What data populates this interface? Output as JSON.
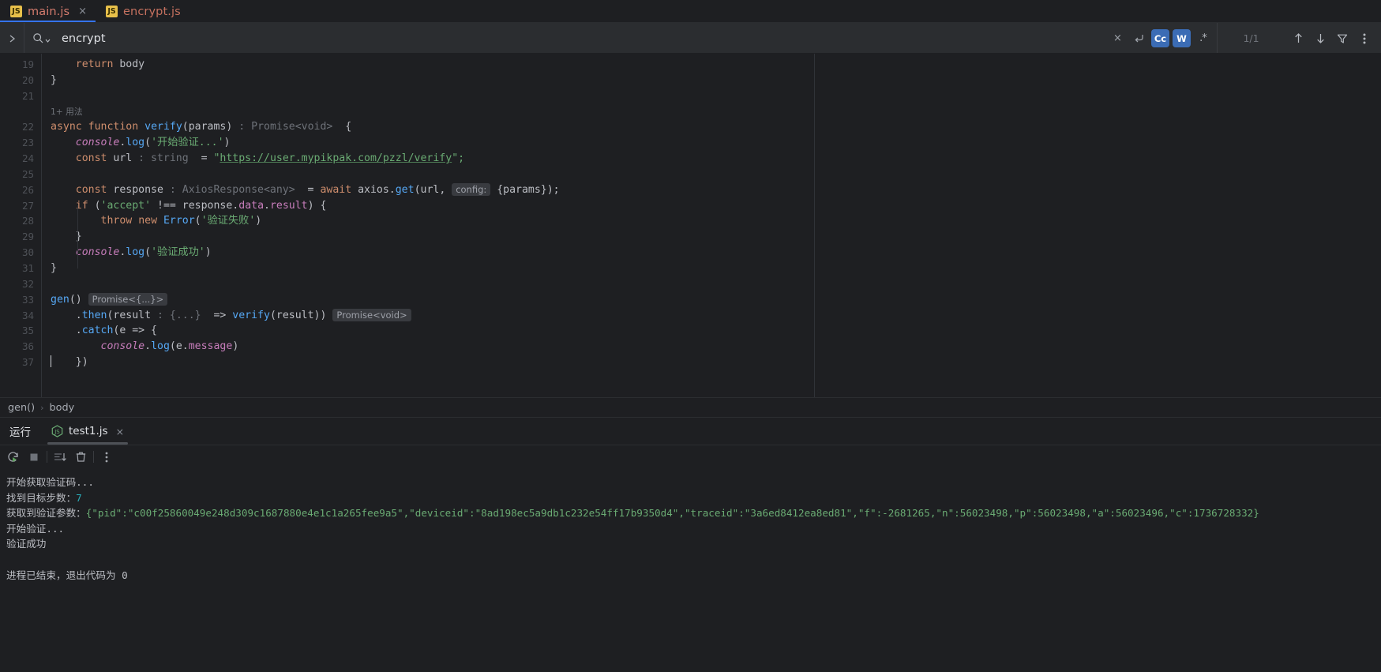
{
  "colors": {
    "bg": "#1e1f22",
    "toolbar_bg": "#2b2d30",
    "accent_blue": "#3574f0",
    "toggle_active": "#3b6cb5",
    "keyword": "#cf8e6d",
    "function": "#56a8f5",
    "string": "#6aab73",
    "number": "#2aacb8",
    "hint": "#6e7279",
    "js_tab": "#d47b6d"
  },
  "tabs": [
    {
      "label": "main.js",
      "icon": "js-file-icon",
      "badge": "JS",
      "active": true,
      "closable": true
    },
    {
      "label": "encrypt.js",
      "icon": "js-file-icon",
      "badge": "JS",
      "active": false,
      "closable": false
    }
  ],
  "search": {
    "expand_icon": "chevron-right-icon",
    "magnifier_icon": "search-dropdown-icon",
    "value": "encrypt",
    "placeholder": "",
    "clear_label": "×",
    "newline_label": "↩",
    "match_case_label": "Cc",
    "words_label": "W",
    "regex_label": ".*",
    "match_case_on": true,
    "words_on": true,
    "regex_on": false,
    "count": "1/1",
    "prev_icon": "arrow-up-icon",
    "next_icon": "arrow-down-icon",
    "filter_icon": "filter-icon",
    "more_icon": "more-vertical-icon"
  },
  "editor": {
    "first_line": 19,
    "usage_hint": "1+ 用法",
    "lines": [
      {
        "num": "19",
        "segments": [
          {
            "t": "    ",
            "c": "ident"
          },
          {
            "t": "return",
            "c": "kw"
          },
          {
            "t": " body",
            "c": "ident"
          }
        ]
      },
      {
        "num": "20",
        "segments": [
          {
            "t": "}",
            "c": "ident"
          }
        ]
      },
      {
        "num": "21",
        "segments": []
      },
      {
        "num": "",
        "segments": [
          {
            "t": "1+ 用法",
            "c": "usage"
          }
        ]
      },
      {
        "num": "22",
        "segments": [
          {
            "t": "async",
            "c": "kw"
          },
          {
            "t": " ",
            "c": "ident"
          },
          {
            "t": "function",
            "c": "kw"
          },
          {
            "t": " ",
            "c": "ident"
          },
          {
            "t": "verify",
            "c": "fn"
          },
          {
            "t": "(params)",
            "c": "ident"
          },
          {
            "t": " : Promise<void>",
            "c": "hint"
          },
          {
            "t": "  {",
            "c": "ident"
          }
        ]
      },
      {
        "num": "23",
        "segments": [
          {
            "t": "    ",
            "c": "ident"
          },
          {
            "t": "console",
            "c": "consolei"
          },
          {
            "t": ".",
            "c": "ident"
          },
          {
            "t": "log",
            "c": "fn"
          },
          {
            "t": "(",
            "c": "ident"
          },
          {
            "t": "'开始验证...'",
            "c": "str"
          },
          {
            "t": ")",
            "c": "ident"
          }
        ]
      },
      {
        "num": "24",
        "segments": [
          {
            "t": "    ",
            "c": "ident"
          },
          {
            "t": "const",
            "c": "kw"
          },
          {
            "t": " url",
            "c": "ident"
          },
          {
            "t": " : string",
            "c": "hint"
          },
          {
            "t": "  = ",
            "c": "ident"
          },
          {
            "t": "\"",
            "c": "str"
          },
          {
            "t": "https://user.mypikpak.com/pzzl/verify",
            "c": "link"
          },
          {
            "t": "\";",
            "c": "str"
          }
        ]
      },
      {
        "num": "25",
        "segments": []
      },
      {
        "num": "26",
        "segments": [
          {
            "t": "    ",
            "c": "ident"
          },
          {
            "t": "const",
            "c": "kw"
          },
          {
            "t": " response",
            "c": "ident"
          },
          {
            "t": " : AxiosResponse<any>",
            "c": "hint"
          },
          {
            "t": "  = ",
            "c": "ident"
          },
          {
            "t": "await",
            "c": "kw"
          },
          {
            "t": " axios",
            "c": "ident"
          },
          {
            "t": ".",
            "c": "ident"
          },
          {
            "t": "get",
            "c": "fn"
          },
          {
            "t": "(url, ",
            "c": "ident"
          },
          {
            "t": "config:",
            "c": "chip"
          },
          {
            "t": " {params});",
            "c": "ident"
          }
        ]
      },
      {
        "num": "27",
        "segments": [
          {
            "t": "    ",
            "c": "ident"
          },
          {
            "t": "if",
            "c": "kw"
          },
          {
            "t": " (",
            "c": "ident"
          },
          {
            "t": "'accept'",
            "c": "str"
          },
          {
            "t": " !== response",
            "c": "ident"
          },
          {
            "t": ".",
            "c": "ident"
          },
          {
            "t": "data",
            "c": "field"
          },
          {
            "t": ".",
            "c": "ident"
          },
          {
            "t": "result",
            "c": "field"
          },
          {
            "t": ") {",
            "c": "ident"
          }
        ]
      },
      {
        "num": "28",
        "segments": [
          {
            "t": "        ",
            "c": "ident"
          },
          {
            "t": "throw",
            "c": "kw"
          },
          {
            "t": " ",
            "c": "ident"
          },
          {
            "t": "new",
            "c": "kw"
          },
          {
            "t": " ",
            "c": "ident"
          },
          {
            "t": "Error",
            "c": "cls"
          },
          {
            "t": "(",
            "c": "ident"
          },
          {
            "t": "'验证失败'",
            "c": "str"
          },
          {
            "t": ")",
            "c": "ident"
          }
        ]
      },
      {
        "num": "29",
        "segments": [
          {
            "t": "    }",
            "c": "ident"
          }
        ]
      },
      {
        "num": "30",
        "segments": [
          {
            "t": "    ",
            "c": "ident"
          },
          {
            "t": "console",
            "c": "consolei"
          },
          {
            "t": ".",
            "c": "ident"
          },
          {
            "t": "log",
            "c": "fn"
          },
          {
            "t": "(",
            "c": "ident"
          },
          {
            "t": "'验证成功'",
            "c": "str"
          },
          {
            "t": ")",
            "c": "ident"
          }
        ]
      },
      {
        "num": "31",
        "segments": [
          {
            "t": "}",
            "c": "ident"
          }
        ]
      },
      {
        "num": "32",
        "segments": []
      },
      {
        "num": "33",
        "segments": [
          {
            "t": "gen",
            "c": "fn"
          },
          {
            "t": "()",
            "c": "ident"
          },
          {
            "t": " ",
            "c": "ident"
          },
          {
            "t": "Promise<{...}>",
            "c": "chip"
          }
        ]
      },
      {
        "num": "34",
        "segments": [
          {
            "t": "    ",
            "c": "ident"
          },
          {
            "t": ".",
            "c": "ident"
          },
          {
            "t": "then",
            "c": "fn"
          },
          {
            "t": "(result",
            "c": "ident"
          },
          {
            "t": " : {...}",
            "c": "hint"
          },
          {
            "t": "  => ",
            "c": "ident"
          },
          {
            "t": "verify",
            "c": "fn"
          },
          {
            "t": "(result))",
            "c": "ident"
          },
          {
            "t": " ",
            "c": "ident"
          },
          {
            "t": "Promise<void>",
            "c": "chip"
          }
        ]
      },
      {
        "num": "35",
        "segments": [
          {
            "t": "    ",
            "c": "ident"
          },
          {
            "t": ".",
            "c": "ident"
          },
          {
            "t": "catch",
            "c": "fn"
          },
          {
            "t": "(e => {",
            "c": "ident"
          }
        ]
      },
      {
        "num": "36",
        "segments": [
          {
            "t": "        ",
            "c": "ident"
          },
          {
            "t": "console",
            "c": "consolei"
          },
          {
            "t": ".",
            "c": "ident"
          },
          {
            "t": "log",
            "c": "fn"
          },
          {
            "t": "(e",
            "c": "ident"
          },
          {
            "t": ".",
            "c": "ident"
          },
          {
            "t": "message",
            "c": "field"
          },
          {
            "t": ")",
            "c": "ident"
          }
        ]
      },
      {
        "num": "37",
        "segments": [
          {
            "t": "    })",
            "c": "ident"
          }
        ]
      }
    ]
  },
  "breadcrumb": {
    "items": [
      "gen()",
      "body"
    ],
    "separator": "›"
  },
  "run": {
    "title": "运行",
    "tab_label": "test1.js",
    "tab_icon": "nodejs-icon",
    "tab_close": "×",
    "toolbar": {
      "rerun": "rerun-icon",
      "stop": "stop-icon",
      "scroll_end": "scroll-to-end-icon",
      "trash": "trash-icon",
      "more": "more-vertical-icon"
    },
    "console_lines": [
      {
        "text": "开始获取验证码...",
        "kind": "plain"
      },
      {
        "text": "找到目标步数：7",
        "kind": "with-number",
        "prefix": "找到目标步数：",
        "number": "7"
      },
      {
        "text": "获取到验证参数：{\"pid\":\"c00f25860049e248d309c1687880e4e1c1a265fee9a5\",\"deviceid\":\"8ad198ec5a9db1c232e54ff17b9350d4\",\"traceid\":\"3a6ed8412ea8ed81\",\"f\":-2681265,\"n\":56023498,\"p\":56023498,\"a\":56023496,\"c\":1736728332}",
        "kind": "json",
        "prefix": "获取到验证参数：",
        "json": "{\"pid\":\"c00f25860049e248d309c1687880e4e1c1a265fee9a5\",\"deviceid\":\"8ad198ec5a9db1c232e54ff17b9350d4\",\"traceid\":\"3a6ed8412ea8ed81\",\"f\":-2681265,\"n\":56023498,\"p\":56023498,\"a\":56023496,\"c\":1736728332}"
      },
      {
        "text": "开始验证...",
        "kind": "plain"
      },
      {
        "text": "验证成功",
        "kind": "plain"
      },
      {
        "text": "",
        "kind": "blank"
      },
      {
        "text": "进程已结束，退出代码为 0",
        "kind": "plain"
      }
    ]
  }
}
